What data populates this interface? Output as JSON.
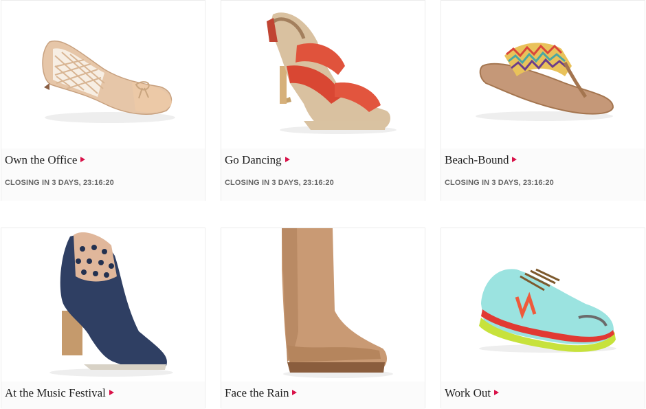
{
  "colors": {
    "accent": "#d9134a",
    "title": "#222222",
    "closing": "#666666"
  },
  "items": [
    {
      "title": "Own the Office",
      "closing": "CLOSING IN 3 DAYS, 23:16:20",
      "image": "beige-laser-cut-ballet-flat"
    },
    {
      "title": "Go Dancing",
      "closing": "CLOSING IN 3 DAYS, 23:16:20",
      "image": "coral-strappy-heel-sandal"
    },
    {
      "title": "Beach-Bound",
      "closing": "CLOSING IN 3 DAYS, 23:16:20",
      "image": "zigzag-thong-sandal"
    },
    {
      "title": "At the Music Festival",
      "image": "navy-cutout-ankle-bootie"
    },
    {
      "title": "Face the Rain",
      "image": "tan-rain-boot"
    },
    {
      "title": "Work Out",
      "image": "turquoise-running-sneaker"
    }
  ]
}
